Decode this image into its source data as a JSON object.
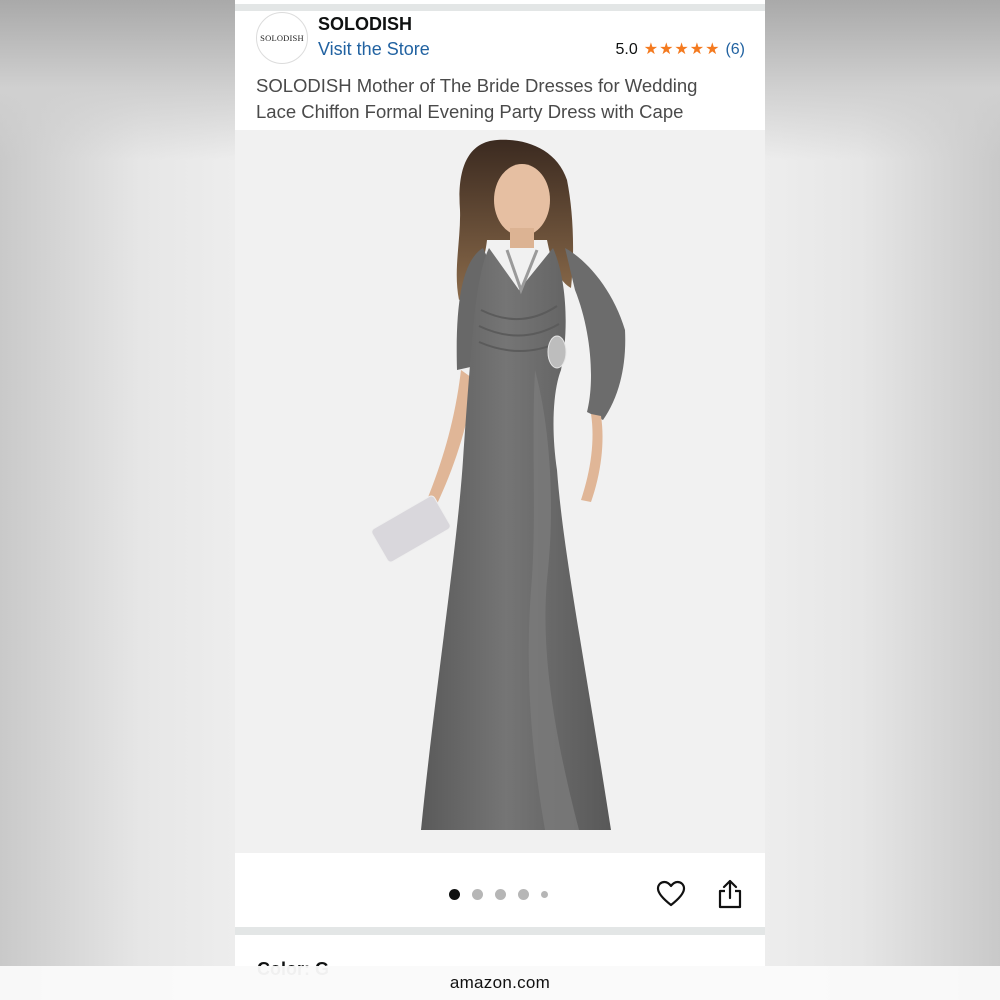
{
  "store": {
    "logo_text": "SOLODISH",
    "brand_name": "SOLODISH",
    "visit_link": "Visit the Store"
  },
  "rating": {
    "value": "5.0",
    "stars": 5,
    "count": "(6)",
    "star_color": "#f47a1f"
  },
  "product": {
    "title_line_1": "SOLODISH Mother of The Bride Dresses for Wedding",
    "title_line_2": "Lace Chiffon Formal Evening Party Dress with Cape"
  },
  "gallery": {
    "image_count": 5,
    "active_index": 0
  },
  "actions": {
    "wishlist_icon": "heart-icon",
    "share_icon": "share-icon"
  },
  "next_section": {
    "label": "Color: G"
  },
  "browser": {
    "url": "amazon.com"
  },
  "colors": {
    "link": "#2162a1",
    "text": "#0f1111",
    "dress": "#6b6b6b"
  }
}
